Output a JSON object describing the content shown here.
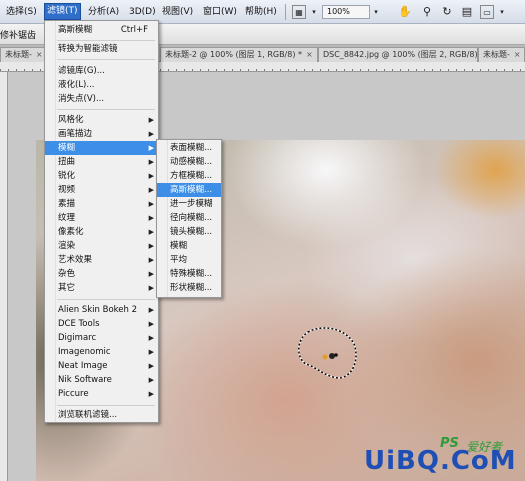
{
  "menubar": {
    "items": [
      {
        "label": "选择(S)",
        "active": false
      },
      {
        "label": "滤镜(T)",
        "active": true
      },
      {
        "label": "分析(A)",
        "active": false
      },
      {
        "label": "3D(D)",
        "active": false
      },
      {
        "label": "视图(V)",
        "active": false
      },
      {
        "label": "窗口(W)",
        "active": false
      },
      {
        "label": "帮助(H)",
        "active": false
      }
    ],
    "zoom": "100%",
    "icons": [
      "layout-icon",
      "zoom-dropdown",
      "hand-tool-icon",
      "zoom-tool-icon",
      "rotate-view-icon",
      "grid-icon",
      "screen-mode-icon"
    ]
  },
  "options_bar": {
    "label": "修补锯齿"
  },
  "tabs": [
    {
      "label": "未标题-",
      "close": "×"
    },
    {
      "label": "未标题-2 @ 100% (图层 1, RGB/8) *",
      "close": "×"
    },
    {
      "label": "DSC_8842.jpg @ 100% (图层 2, RGB/8) *",
      "close": "×"
    },
    {
      "label": "未标题-",
      "close": "×"
    }
  ],
  "filter_menu": {
    "items": [
      {
        "label": "高斯模糊",
        "shortcut": "Ctrl+F"
      },
      {
        "label": "转换为智能滤镜"
      },
      {
        "label": "滤镜库(G)..."
      },
      {
        "label": "液化(L)..."
      },
      {
        "label": "消失点(V)..."
      },
      {
        "label": "风格化",
        "submenu": true
      },
      {
        "label": "画笔描边",
        "submenu": true
      },
      {
        "label": "模糊",
        "submenu": true,
        "highlighted": true
      },
      {
        "label": "扭曲",
        "submenu": true
      },
      {
        "label": "锐化",
        "submenu": true
      },
      {
        "label": "视频",
        "submenu": true
      },
      {
        "label": "素描",
        "submenu": true
      },
      {
        "label": "纹理",
        "submenu": true
      },
      {
        "label": "像素化",
        "submenu": true
      },
      {
        "label": "渲染",
        "submenu": true
      },
      {
        "label": "艺术效果",
        "submenu": true
      },
      {
        "label": "杂色",
        "submenu": true
      },
      {
        "label": "其它",
        "submenu": true
      },
      {
        "label": "Alien Skin Bokeh 2",
        "submenu": true
      },
      {
        "label": "DCE Tools",
        "submenu": true
      },
      {
        "label": "Digimarc",
        "submenu": true
      },
      {
        "label": "Imagenomic",
        "submenu": true
      },
      {
        "label": "Neat Image",
        "submenu": true
      },
      {
        "label": "Nik Software",
        "submenu": true
      },
      {
        "label": "Piccure",
        "submenu": true
      },
      {
        "label": "浏览联机滤镜..."
      }
    ]
  },
  "blur_submenu": {
    "items": [
      {
        "label": "表面模糊..."
      },
      {
        "label": "动感模糊..."
      },
      {
        "label": "方框模糊..."
      },
      {
        "label": "高斯模糊...",
        "highlighted": true
      },
      {
        "label": "进一步模糊"
      },
      {
        "label": "径向模糊..."
      },
      {
        "label": "镜头模糊..."
      },
      {
        "label": "模糊"
      },
      {
        "label": "平均"
      },
      {
        "label": "特殊模糊..."
      },
      {
        "label": "形状模糊..."
      }
    ]
  },
  "watermark": {
    "brand": "UiBQ.CoM",
    "ps": "PS",
    "cn": "爱好者",
    "brand_color": "#1e4fb4",
    "accent_color": "#2f9a3a"
  },
  "colors": {
    "menu_highlight": "#3d8ee6",
    "menubar_active": "#2f6fc9"
  }
}
